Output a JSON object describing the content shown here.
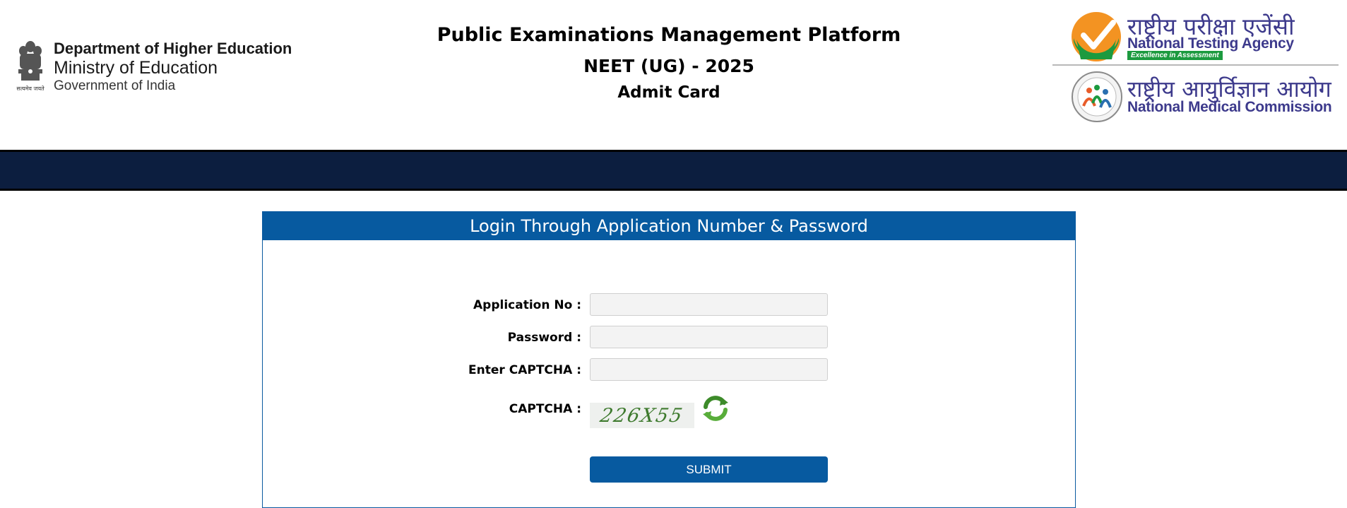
{
  "header": {
    "dept_line1": "Department of Higher Education",
    "dept_line2": "Ministry of Education",
    "dept_line3": "Government of India",
    "emblem_caption": "सत्यमेव जयते",
    "title": "Public Examinations Management Platform",
    "exam": "NEET (UG) - 2025",
    "subtitle": "Admit Card",
    "nta_hindi": "राष्ट्रीय परीक्षा एजेंसी",
    "nta_english": "National Testing Agency",
    "nta_tagline": "Excellence in Assessment",
    "nmc_hindi": "राष्ट्रीय आयुर्विज्ञान आयोग",
    "nmc_english": "National Medical Commission"
  },
  "login": {
    "heading": "Login Through Application Number & Password",
    "application_label": "Application No :",
    "application_value": "",
    "password_label": "Password :",
    "password_value": "",
    "captcha_input_label": "Enter CAPTCHA :",
    "captcha_input_value": "",
    "captcha_label": "CAPTCHA :",
    "captcha_text": "226X55",
    "refresh_icon": "refresh-icon",
    "submit_label": "SUBMIT"
  },
  "colors": {
    "navbar": "#0c1e3f",
    "primary": "#075aa0",
    "nta_purple": "#3d3a8c",
    "nta_green": "#1c9a3f",
    "nta_orange": "#f39322"
  }
}
